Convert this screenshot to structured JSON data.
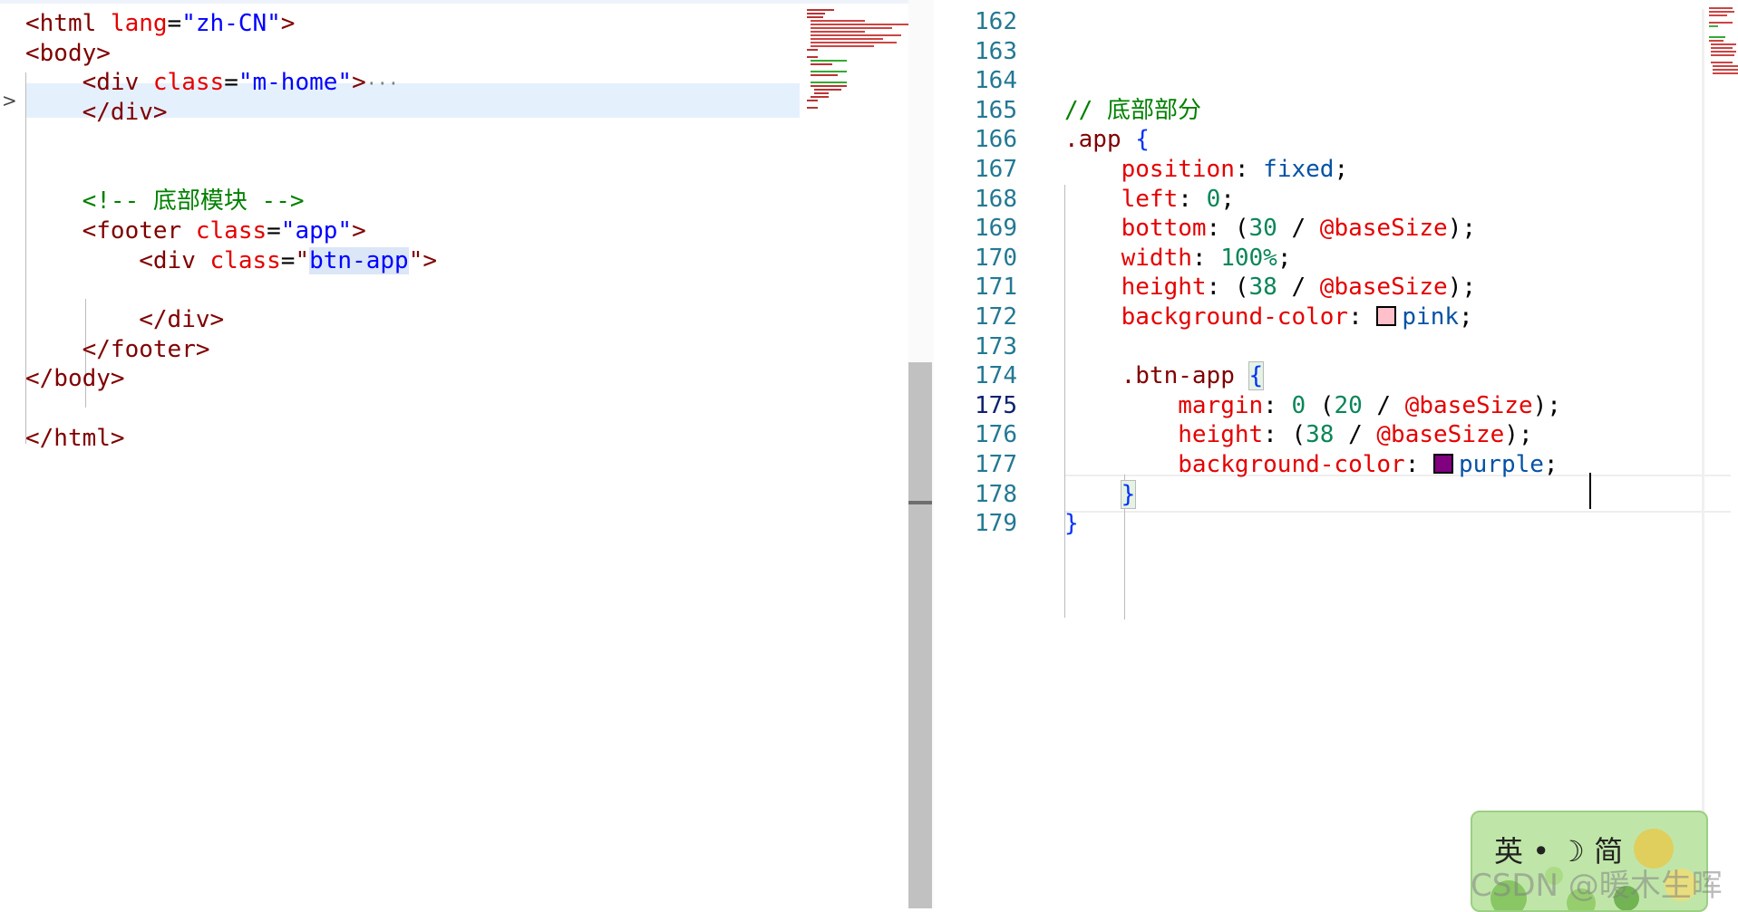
{
  "left_editor": {
    "lines": [
      {
        "indent": "",
        "tokens": [
          [
            "tag",
            "<html "
          ],
          [
            "attr",
            "lang"
          ],
          [
            "eq",
            "="
          ],
          [
            "str",
            "\"zh-CN\""
          ],
          [
            "tag",
            ">"
          ]
        ]
      },
      {
        "indent": "",
        "tokens": [
          [
            "tag",
            "<body>"
          ]
        ]
      },
      {
        "indent": "    ",
        "tokens": [
          [
            "tag",
            "<div "
          ],
          [
            "attr",
            "class"
          ],
          [
            "eq",
            "="
          ],
          [
            "str",
            "\"m-home\""
          ],
          [
            "tag",
            ">"
          ]
        ]
      },
      {
        "indent": "    ",
        "tokens": [
          [
            "tag",
            "</div>"
          ]
        ]
      },
      {
        "indent": "",
        "tokens": []
      },
      {
        "indent": "",
        "tokens": []
      },
      {
        "indent": "    ",
        "tokens": [
          [
            "comment",
            "<!-- 底部模块 -->"
          ]
        ]
      },
      {
        "indent": "    ",
        "tokens": [
          [
            "tag",
            "<footer "
          ],
          [
            "attr",
            "class"
          ],
          [
            "eq",
            "="
          ],
          [
            "str",
            "\"app\""
          ],
          [
            "tag",
            ">"
          ]
        ]
      },
      {
        "indent": "        ",
        "tokens": [
          [
            "tag",
            "<div "
          ],
          [
            "attr",
            "class"
          ],
          [
            "eq",
            "="
          ],
          [
            "tag",
            "\""
          ],
          [
            "strhl",
            "btn-app"
          ],
          [
            "tag",
            "\">"
          ]
        ]
      },
      {
        "indent": "",
        "tokens": []
      },
      {
        "indent": "        ",
        "tokens": [
          [
            "tag",
            "</div>"
          ]
        ]
      },
      {
        "indent": "    ",
        "tokens": [
          [
            "tag",
            "</footer>"
          ]
        ]
      },
      {
        "indent": "",
        "tokens": [
          [
            "tag",
            "</body>"
          ]
        ]
      },
      {
        "indent": "",
        "tokens": []
      },
      {
        "indent": "",
        "tokens": [
          [
            "tag",
            "</html>"
          ]
        ]
      }
    ],
    "folded_ellipsis": "···"
  },
  "right_editor": {
    "current_line": 175,
    "lines": [
      {
        "num": "162",
        "indent": "",
        "tokens": []
      },
      {
        "num": "163",
        "indent": "",
        "tokens": []
      },
      {
        "num": "164",
        "indent": "",
        "tokens": []
      },
      {
        "num": "165",
        "indent": "",
        "tokens": [
          [
            "comment",
            "// 底部部分"
          ]
        ]
      },
      {
        "num": "166",
        "indent": "",
        "tokens": [
          [
            "sel",
            ".app "
          ],
          [
            "brace",
            "{"
          ]
        ]
      },
      {
        "num": "167",
        "indent": "    ",
        "tokens": [
          [
            "prop",
            "position"
          ],
          [
            "punc",
            ": "
          ],
          [
            "kw",
            "fixed"
          ],
          [
            "punc",
            ";"
          ]
        ]
      },
      {
        "num": "168",
        "indent": "    ",
        "tokens": [
          [
            "prop",
            "left"
          ],
          [
            "punc",
            ": "
          ],
          [
            "num",
            "0"
          ],
          [
            "punc",
            ";"
          ]
        ]
      },
      {
        "num": "169",
        "indent": "    ",
        "tokens": [
          [
            "prop",
            "bottom"
          ],
          [
            "punc",
            ": ("
          ],
          [
            "num",
            "30"
          ],
          [
            "punc",
            " / "
          ],
          [
            "var",
            "@baseSize"
          ],
          [
            "punc",
            ");"
          ]
        ]
      },
      {
        "num": "170",
        "indent": "    ",
        "tokens": [
          [
            "prop",
            "width"
          ],
          [
            "punc",
            ": "
          ],
          [
            "num",
            "100%"
          ],
          [
            "punc",
            ";"
          ]
        ]
      },
      {
        "num": "171",
        "indent": "    ",
        "tokens": [
          [
            "prop",
            "height"
          ],
          [
            "punc",
            ": ("
          ],
          [
            "num",
            "38"
          ],
          [
            "punc",
            " / "
          ],
          [
            "var",
            "@baseSize"
          ],
          [
            "punc",
            ");"
          ]
        ]
      },
      {
        "num": "172",
        "indent": "    ",
        "tokens": [
          [
            "prop",
            "background-color"
          ],
          [
            "punc",
            ": "
          ],
          [
            "swatch",
            "#ffc0cb"
          ],
          [
            "kw",
            "pink"
          ],
          [
            "punc",
            ";"
          ]
        ]
      },
      {
        "num": "173",
        "indent": "",
        "tokens": []
      },
      {
        "num": "174",
        "indent": "    ",
        "tokens": [
          [
            "sel",
            ".btn-app "
          ],
          [
            "bracehl",
            "{"
          ]
        ]
      },
      {
        "num": "175",
        "indent": "        ",
        "tokens": [
          [
            "prop",
            "margin"
          ],
          [
            "punc",
            ": "
          ],
          [
            "num",
            "0"
          ],
          [
            "punc",
            " ("
          ],
          [
            "num",
            "20"
          ],
          [
            "punc",
            " / "
          ],
          [
            "var",
            "@baseSize"
          ],
          [
            "punc",
            ");"
          ]
        ]
      },
      {
        "num": "176",
        "indent": "        ",
        "tokens": [
          [
            "prop",
            "height"
          ],
          [
            "punc",
            ": ("
          ],
          [
            "num",
            "38"
          ],
          [
            "punc",
            " / "
          ],
          [
            "var",
            "@baseSize"
          ],
          [
            "punc",
            ");"
          ]
        ]
      },
      {
        "num": "177",
        "indent": "        ",
        "tokens": [
          [
            "prop",
            "background-color"
          ],
          [
            "punc",
            ": "
          ],
          [
            "swatch",
            "#800080"
          ],
          [
            "kw",
            "purple"
          ],
          [
            "punc",
            ";"
          ]
        ]
      },
      {
        "num": "178",
        "indent": "    ",
        "tokens": [
          [
            "bracehl",
            "}"
          ]
        ]
      },
      {
        "num": "179",
        "indent": "",
        "tokens": [
          [
            "brace",
            "}"
          ]
        ]
      }
    ]
  },
  "ime": {
    "label_en": "英",
    "label_dot": "•",
    "label_moon": "☽",
    "label_cn": "简"
  },
  "watermark": "CSDN @暖木生晖",
  "colors": {
    "pink": "#ffc0cb",
    "purple": "#800080"
  },
  "icons": {
    "fold": "chevron-right-icon",
    "ime_moon": "moon-icon"
  }
}
